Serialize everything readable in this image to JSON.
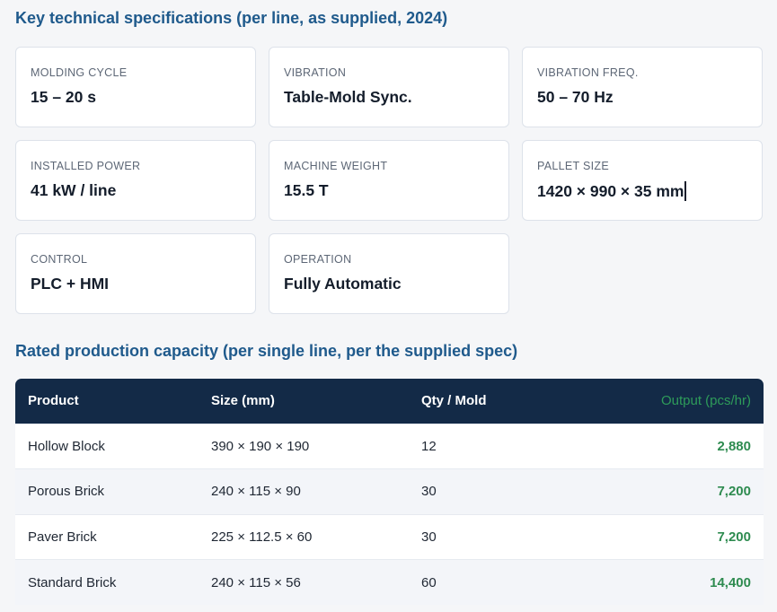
{
  "specs": {
    "title": "Key technical specifications (per line, as supplied, 2024)",
    "cards": [
      {
        "label": "MOLDING CYCLE",
        "value": "15 – 20 s"
      },
      {
        "label": "VIBRATION",
        "value": "Table-Mold Sync."
      },
      {
        "label": "VIBRATION FREQ.",
        "value": "50 – 70 Hz"
      },
      {
        "label": "INSTALLED POWER",
        "value": "41 kW / line"
      },
      {
        "label": "MACHINE WEIGHT",
        "value": "15.5 T"
      },
      {
        "label": "PALLET SIZE",
        "value": "1420 × 990 × 35 mm"
      },
      {
        "label": "CONTROL",
        "value": "PLC + HMI"
      },
      {
        "label": "OPERATION",
        "value": "Fully Automatic"
      }
    ]
  },
  "capacity": {
    "title": "Rated production capacity (per single line, per the supplied spec)",
    "columns": [
      "Product",
      "Size (mm)",
      "Qty / Mold",
      "Output (pcs/hr)"
    ],
    "rows": [
      {
        "product": "Hollow Block",
        "size": "390 × 190 × 190",
        "qty": "12",
        "output": "2,880"
      },
      {
        "product": "Porous Brick",
        "size": "240 × 115 × 90",
        "qty": "30",
        "output": "7,200"
      },
      {
        "product": "Paver Brick",
        "size": "225 × 112.5 × 60",
        "qty": "30",
        "output": "7,200"
      },
      {
        "product": "Standard Brick",
        "size": "240 × 115 × 56",
        "qty": "60",
        "output": "14,400"
      }
    ]
  }
}
